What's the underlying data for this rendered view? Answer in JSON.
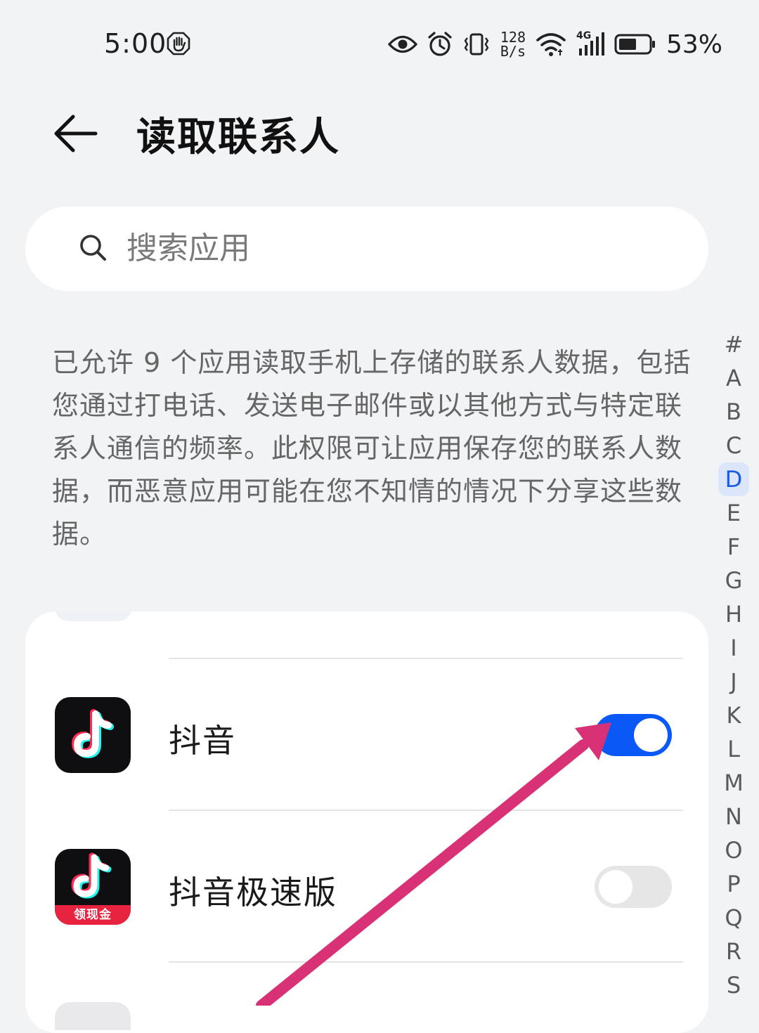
{
  "status_bar": {
    "time": "5:00",
    "net_rate_top": "128",
    "net_rate_bottom": "B/s",
    "network_type": "4G",
    "battery_percent": "53%",
    "icons": [
      "hand-icon",
      "eye-icon",
      "alarm-icon",
      "vibrate-icon",
      "wifi-icon",
      "cellular-signal-icon",
      "battery-icon"
    ]
  },
  "header": {
    "title": "读取联系人",
    "back_icon": "back-arrow-icon"
  },
  "search": {
    "placeholder": "搜索应用",
    "icon": "search-icon"
  },
  "description": "已允许 9 个应用读取手机上存储的联系人数据，包括您通过打电话、发送电子邮件或以其他方式与特定联系人通信的频率。此权限可让应用保存您的联系人数据，而恶意应用可能在您不知情的情况下分享这些数据。",
  "alphabet_index": {
    "letters": [
      "#",
      "A",
      "B",
      "C",
      "D",
      "E",
      "F",
      "G",
      "H",
      "I",
      "J",
      "K",
      "L",
      "M",
      "N",
      "O",
      "P",
      "Q",
      "R",
      "S"
    ],
    "active": "D"
  },
  "apps": [
    {
      "name": "抖音",
      "icon": "douyin-icon",
      "enabled": true
    },
    {
      "name": "抖音极速版",
      "icon": "douyin-lite-icon",
      "badge": "领现金",
      "enabled": false
    }
  ],
  "colors": {
    "background": "#f1f3f5",
    "accent": "#0a59f7",
    "toggle_off": "#e6e6e6",
    "annotation_arrow": "#d93175"
  }
}
